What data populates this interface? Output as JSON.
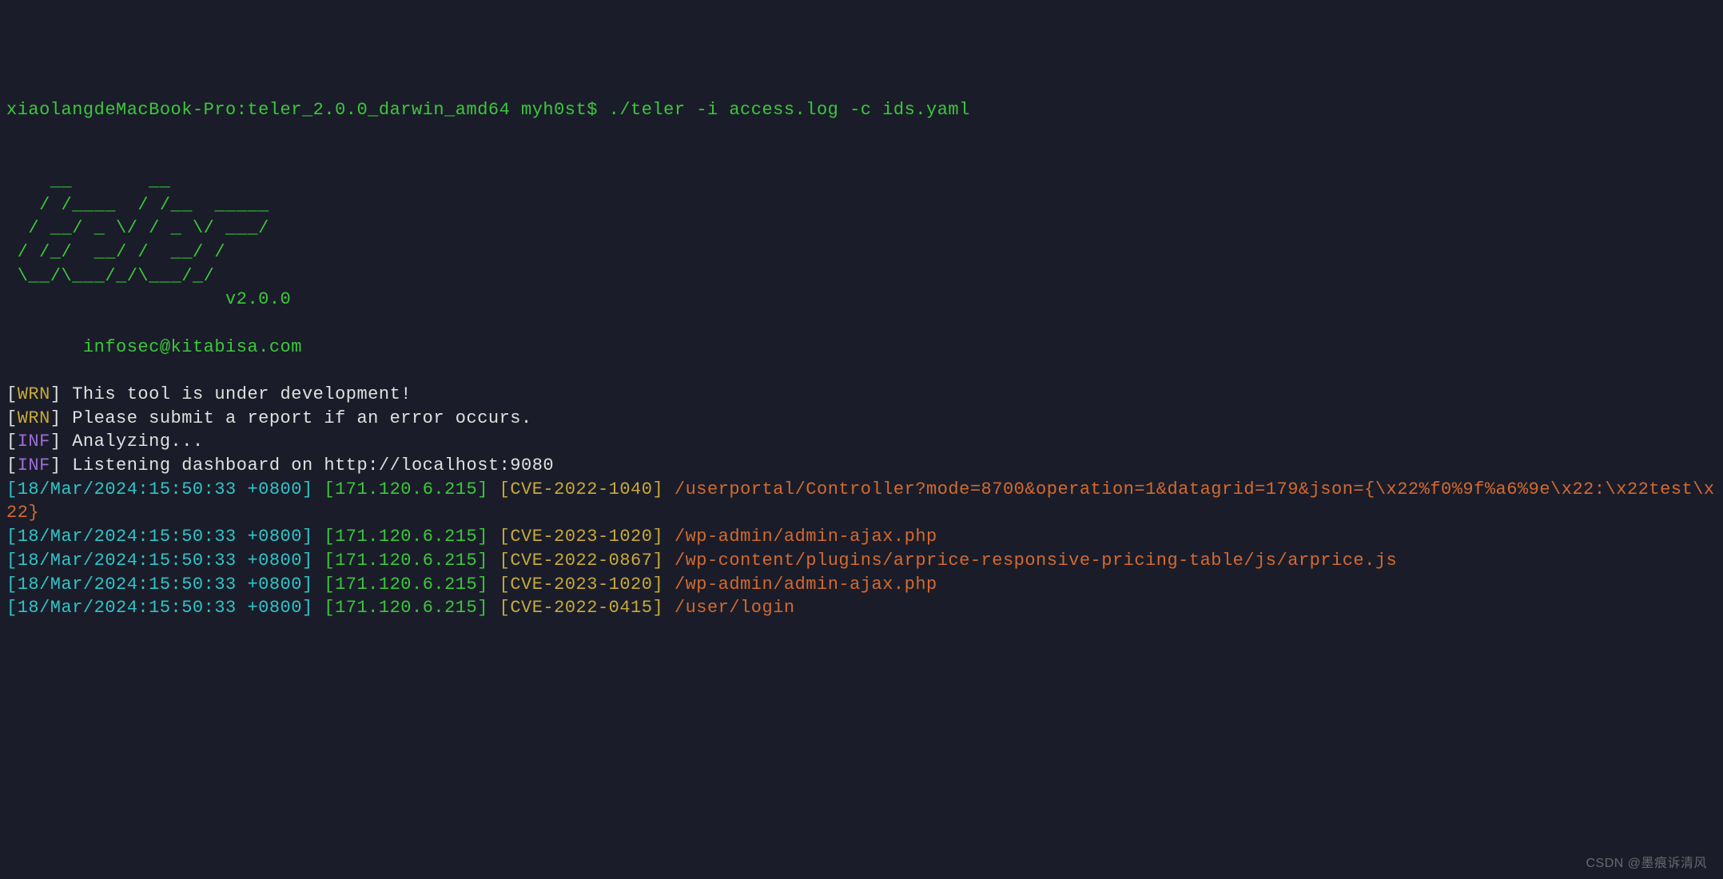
{
  "prompt": {
    "host": "xiaolangdeMacBook-Pro:teler_2.0.0_darwin_amd64 myh0st$ ",
    "command": "./teler -i access.log -c ids.yaml"
  },
  "ascii_art": "    __       __\n   / /____  / /__  _____\n  / __/ _ \\/ / _ \\/ ___/\n / /_/  __/ /  __/ /\n \\__/\\___/_/\\___/_/",
  "version": "v2.0.0",
  "contact": "infosec@kitabisa.com",
  "warnings": [
    {
      "tag": "[WRN]",
      "msg": " This tool is under development!"
    },
    {
      "tag": "[WRN]",
      "msg": " Please submit a report if an error occurs."
    }
  ],
  "info": [
    {
      "tag": "[INF]",
      "msg": " Analyzing..."
    },
    {
      "tag": "[INF]",
      "msg": " Listening dashboard on http://localhost:9080"
    }
  ],
  "entries": [
    {
      "ts": "[18/Mar/2024:15:50:33 +0800]",
      "ip": "[171.120.6.215]",
      "cve": "[CVE-2022-1040]",
      "path": "/userportal/Controller?mode=8700&operation=1&datagrid=179&json={\\x22%f0%9f%a6%9e\\x22:\\x22test\\x22}"
    },
    {
      "ts": "[18/Mar/2024:15:50:33 +0800]",
      "ip": "[171.120.6.215]",
      "cve": "[CVE-2023-1020]",
      "path": "/wp-admin/admin-ajax.php"
    },
    {
      "ts": "[18/Mar/2024:15:50:33 +0800]",
      "ip": "[171.120.6.215]",
      "cve": "[CVE-2022-0867]",
      "path": "/wp-content/plugins/arprice-responsive-pricing-table/js/arprice.js"
    },
    {
      "ts": "[18/Mar/2024:15:50:33 +0800]",
      "ip": "[171.120.6.215]",
      "cve": "[CVE-2023-1020]",
      "path": "/wp-admin/admin-ajax.php"
    },
    {
      "ts": "[18/Mar/2024:15:50:33 +0800]",
      "ip": "[171.120.6.215]",
      "cve": "[CVE-2022-0415]",
      "path": "/user/login"
    }
  ],
  "watermark": "CSDN @墨痕诉清风"
}
